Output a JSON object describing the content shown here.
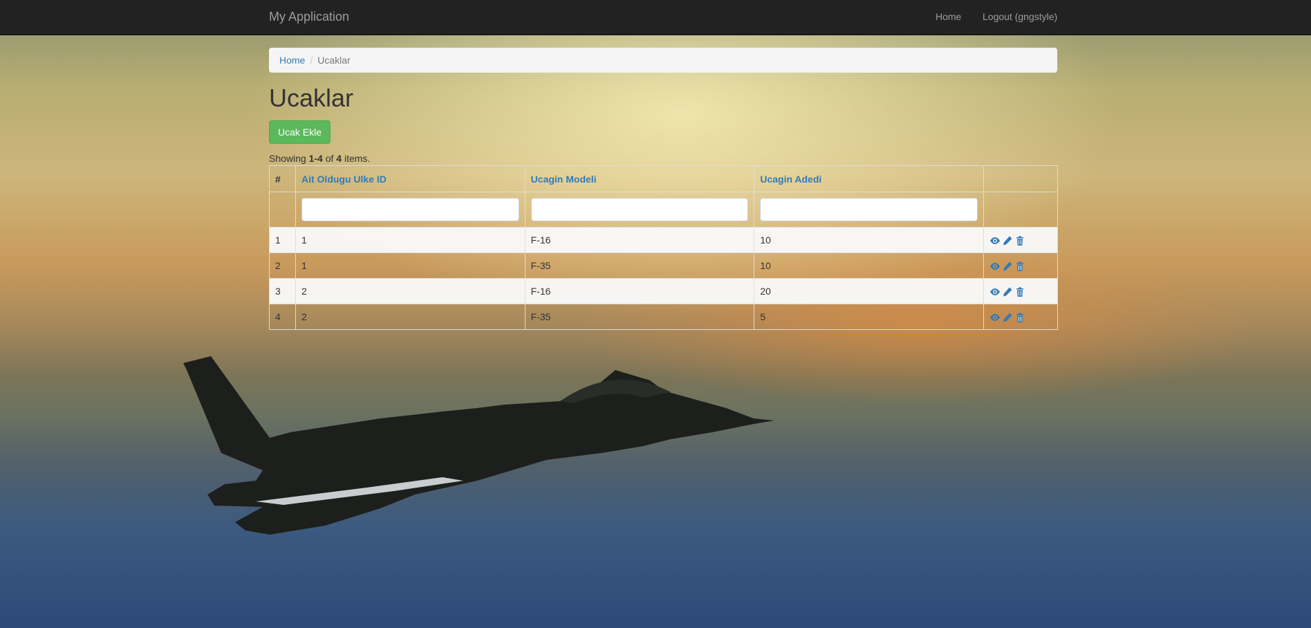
{
  "navbar": {
    "brand": "My Application",
    "items": [
      {
        "label": "Home"
      },
      {
        "label": "Logout (gngstyle)"
      }
    ]
  },
  "breadcrumb": {
    "home": "Home",
    "separator": "/",
    "current": "Ucaklar"
  },
  "page": {
    "title": "Ucaklar",
    "create_button": "Ucak Ekle"
  },
  "summary": {
    "prefix": "Showing ",
    "range": "1-4",
    "middle": " of ",
    "total": "4",
    "suffix": " items."
  },
  "table": {
    "columns": [
      "#",
      "Ait Oldugu Ulke ID",
      "Ucagin Modeli",
      "Ucagin Adedi",
      ""
    ],
    "filters": [
      "",
      "",
      ""
    ],
    "rows": [
      {
        "num": "1",
        "country_id": "1",
        "model": "F-16",
        "count": "10"
      },
      {
        "num": "2",
        "country_id": "1",
        "model": "F-35",
        "count": "10"
      },
      {
        "num": "3",
        "country_id": "2",
        "model": "F-16",
        "count": "20"
      },
      {
        "num": "4",
        "country_id": "2",
        "model": "F-35",
        "count": "5"
      }
    ],
    "action_icons": [
      "eye-icon",
      "pencil-icon",
      "trash-icon"
    ]
  },
  "colors": {
    "navbar_bg": "#222222",
    "link": "#337ab7",
    "success": "#5cb85c"
  }
}
